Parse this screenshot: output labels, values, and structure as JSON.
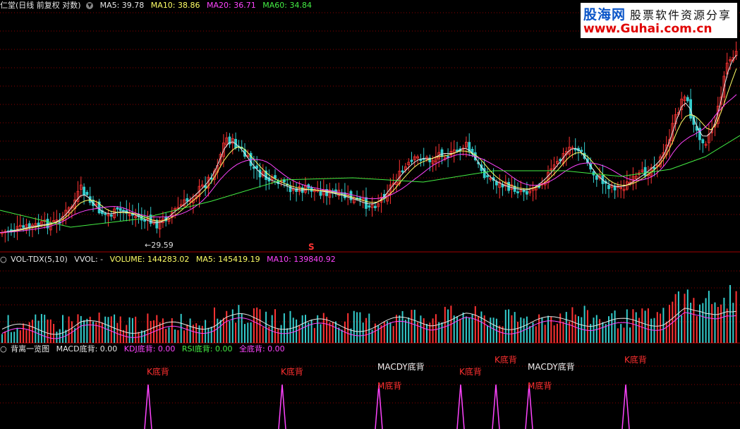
{
  "price_panel": {
    "title": "仁堂(日线 前复权 对数)",
    "button_icon": "chevron-down-icon",
    "button_glyph": "▼",
    "ma5": "MA5: 39.78",
    "ma10": "MA10: 38.86",
    "ma20": "MA20: 36.71",
    "ma60": "MA60: 34.84",
    "low_label": "←29.59",
    "s_marker": "S"
  },
  "volume_panel": {
    "circle_glyph": "○",
    "name": "VOL-TDX(5,10)",
    "vvol": "VVOL: -",
    "volume": "VOLUME: 144283.02",
    "ma5": "MA5: 145419.19",
    "ma10": "MA10: 139840.92"
  },
  "indicator_panel": {
    "circle_glyph": "○",
    "name": "背离一览图",
    "macd": "MACD底背: 0.00",
    "kdj": "KDJ底背: 0.00",
    "rsi": "RSI底背: 0.00",
    "all": "全底背: 0.00",
    "signals": [
      {
        "label": "K底背",
        "color": "red"
      },
      {
        "label": "K底背",
        "color": "red"
      },
      {
        "label": "MACDY底背",
        "color": "white"
      },
      {
        "label": "M底背",
        "color": "red"
      },
      {
        "label": "K底背",
        "color": "red"
      },
      {
        "label": "K底背",
        "color": "red"
      },
      {
        "label": "MACDY底背",
        "color": "white"
      },
      {
        "label": "M底背",
        "color": "red"
      },
      {
        "label": "K底背",
        "color": "red"
      }
    ]
  },
  "watermark": {
    "line1": "股海网",
    "line1b": "股票软件资源分享",
    "line2": "www.Guhai.com.cn"
  },
  "colors": {
    "up": "#ff3333",
    "down": "#33cccc",
    "ma5": "#e6e6e6",
    "ma10": "#ffff66",
    "ma20": "#ff44ff",
    "ma60": "#44ee44",
    "grid": "#8b0000",
    "spike": "#ff44ff"
  }
}
